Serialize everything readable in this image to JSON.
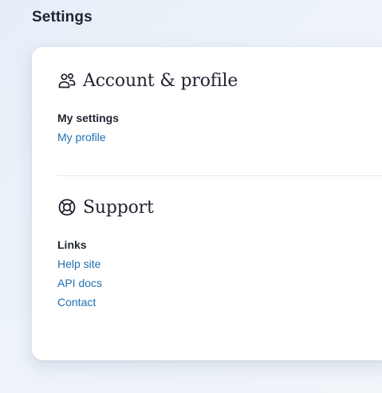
{
  "page": {
    "title": "Settings"
  },
  "sections": {
    "account": {
      "icon": "people-icon",
      "title": "Account & profile",
      "group_label": "My settings",
      "links": [
        "My profile"
      ]
    },
    "support": {
      "icon": "lifebuoy-icon",
      "title": "Support",
      "group_label": "Links",
      "links": [
        "Help site",
        "API docs",
        "Contact"
      ]
    }
  },
  "colors": {
    "link": "#1f6fb2",
    "heading": "#1f2430",
    "background": "#eaf1f8",
    "card": "#ffffff"
  }
}
